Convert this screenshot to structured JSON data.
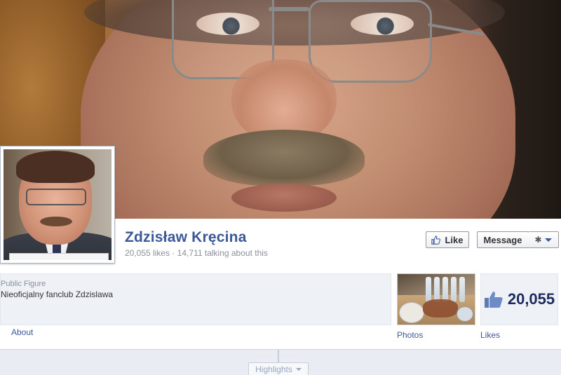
{
  "page": {
    "name": "Zdzisław Kręcina",
    "stats": "20,055 likes · 14,711 talking about this",
    "category": "Public Figure",
    "description": "Nieoficjalny fanclub Zdzislawa"
  },
  "actions": {
    "like_label": "Like",
    "message_label": "Message",
    "settings_icon": "gear-icon"
  },
  "tabs": {
    "about_label": "About",
    "photos_label": "Photos",
    "likes_label": "Likes",
    "likes_count": "20,055"
  },
  "timeline": {
    "highlights_label": "Highlights"
  },
  "colors": {
    "brand_blue": "#3b5998",
    "panel_bg": "#eef1f6"
  }
}
